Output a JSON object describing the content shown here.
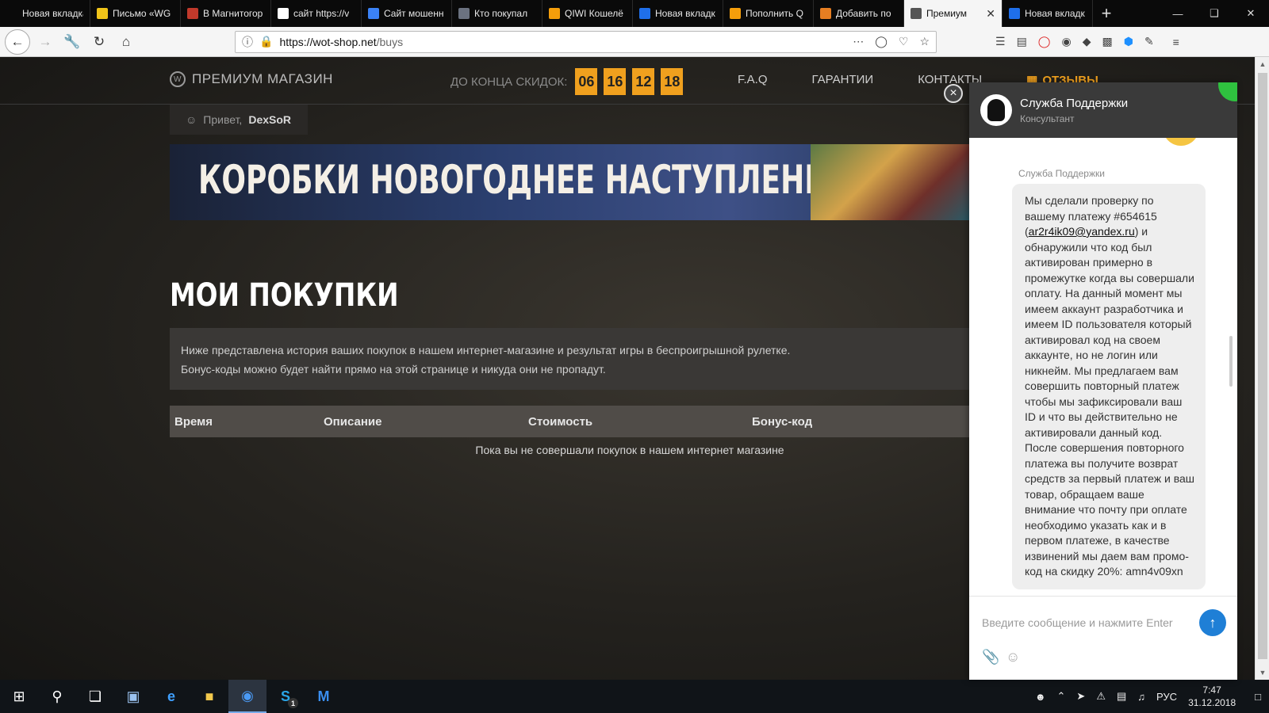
{
  "browser": {
    "tabs": [
      {
        "label": "Новая вкладка",
        "icon": "new-tab-icon",
        "color": "#0a0a0a"
      },
      {
        "label": "Письмо «WG",
        "icon": "mail-icon",
        "color": "#f0c419"
      },
      {
        "label": "В Магнитогор",
        "icon": "news-icon",
        "color": "#c0392b"
      },
      {
        "label": "сайт https://v",
        "icon": "google-icon",
        "color": "#ffffff"
      },
      {
        "label": "Сайт мошенн",
        "icon": "chat-icon",
        "color": "#3b82f6"
      },
      {
        "label": "Кто покупал",
        "icon": "mask-icon",
        "color": "#6b7280"
      },
      {
        "label": "QIWI Кошелё",
        "icon": "qiwi-icon",
        "color": "#f59e0b"
      },
      {
        "label": "Новая вкладк",
        "icon": "firefox-icon",
        "color": "#1f6feb"
      },
      {
        "label": "Пополнить Q",
        "icon": "qiwi-icon",
        "color": "#f59e0b"
      },
      {
        "label": "Добавить по",
        "icon": "firefox-icon",
        "color": "#e67e22"
      },
      {
        "label": "Премиум",
        "icon": "shield-icon",
        "color": "#555555",
        "active": true
      },
      {
        "label": "Новая вкладк",
        "icon": "firefox-icon",
        "color": "#1f6feb"
      }
    ],
    "url_host": "https://wot-shop.net",
    "url_path": "/buys"
  },
  "site": {
    "logo_text": "ПРЕМИУМ МАГАЗИН",
    "countdown_label": "ДО КОНЦА СКИДОК:",
    "countdown": [
      "06",
      "16",
      "12",
      "18"
    ],
    "nav": {
      "faq": "F.A.Q",
      "guarantees": "ГАРАНТИИ",
      "contacts": "КОНТАКТЫ",
      "reviews": "ОТЗЫВЫ"
    },
    "greeting_prefix": "Привет,",
    "username": "DexSoR",
    "banner_text": "КОРОБКИ НОВОГОДНЕЕ НАСТУПЛЕНИЕ",
    "page_title": "МОИ ПОКУПКИ",
    "info_line1": "Ниже представлена история ваших покупок в нашем интернет-магазине и результат игры в беспроигрышной рулетке.",
    "info_line2": "Бонус-коды можно будет найти прямо на этой странице и никуда они не пропадут.",
    "table_headers": [
      "Время",
      "Описание",
      "Стоимость",
      "Бонус-код"
    ],
    "empty_message": "Пока вы не совершали покупок в нашем интернет магазине"
  },
  "chat": {
    "title": "Служба Поддержки",
    "subtitle": "Консультант",
    "sender": "Служба Поддержки",
    "message_part1": "Мы сделали проверку по вашему платежу #654615 (",
    "email": "ar2r4ik09@yandex.ru",
    "message_part2": ") и обнаружили что код был активирован примерно в промежутке когда вы совершали оплату. На данный момент мы имеем аккаунт разработчика и имеем ID пользователя который активировал код на своем аккаунте, но не логин или никнейм. Мы предлагаем вам совершить повторный платеж чтобы мы зафиксировали ваш ID и что вы действительно не активировали данный код. После совершения повторного платежа вы получите возврат средств за первый платеж и ваш товар, обращаем ваше внимание что почту при оплате необходимо указать как и в первом платеже, в качестве извинений мы даем вам промо-код на скидку 20%: amn4v09xn",
    "input_placeholder": "Введите сообщение и нажмите Enter"
  },
  "taskbar": {
    "lang": "РУС",
    "time": "7:47",
    "date": "31.12.2018",
    "skype_badge": "1"
  }
}
